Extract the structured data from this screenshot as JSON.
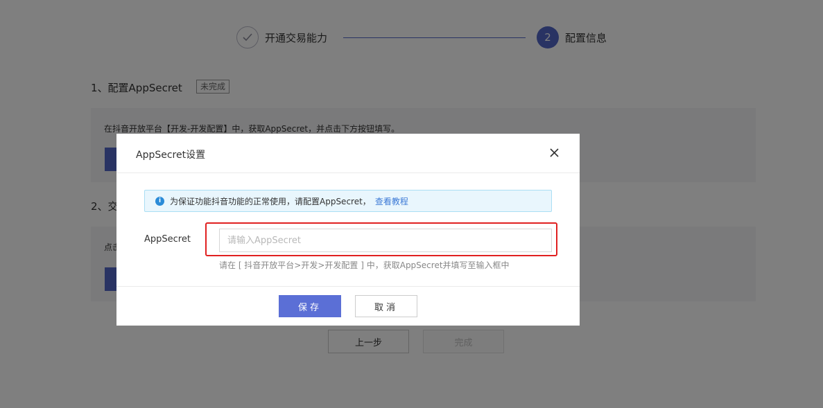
{
  "steps": [
    {
      "label": "开通交易能力",
      "status": "done"
    },
    {
      "number": "2",
      "label": "配置信息",
      "status": "active"
    }
  ],
  "section1": {
    "title": "1、配置AppSecret",
    "badge": "未完成",
    "text": "在抖音开放平台【开发-开发配置】中，获取AppSecret，并点击下方按钮填写。"
  },
  "section2": {
    "title": "2、交",
    "text": "点击"
  },
  "bottom_buttons": {
    "prev": "上一步",
    "done": "完成"
  },
  "modal": {
    "title": "AppSecret设置",
    "close": "X",
    "tip": {
      "text": "为保证功能抖音功能的正常使用，请配置AppSecret，",
      "link": "查看教程"
    },
    "field": {
      "label": "AppSecret",
      "value": "",
      "placeholder": "请输入AppSecret",
      "hint": "请在 [ 抖音开放平台>开发>开发配置 ] 中，获取AppSecret并填写至输入框中"
    },
    "save": "保存",
    "cancel": "取消"
  },
  "colors": {
    "primary": "#5266c6",
    "highlight": "#e02020",
    "info": "#2a8bd8",
    "link": "#3d7ad6"
  }
}
